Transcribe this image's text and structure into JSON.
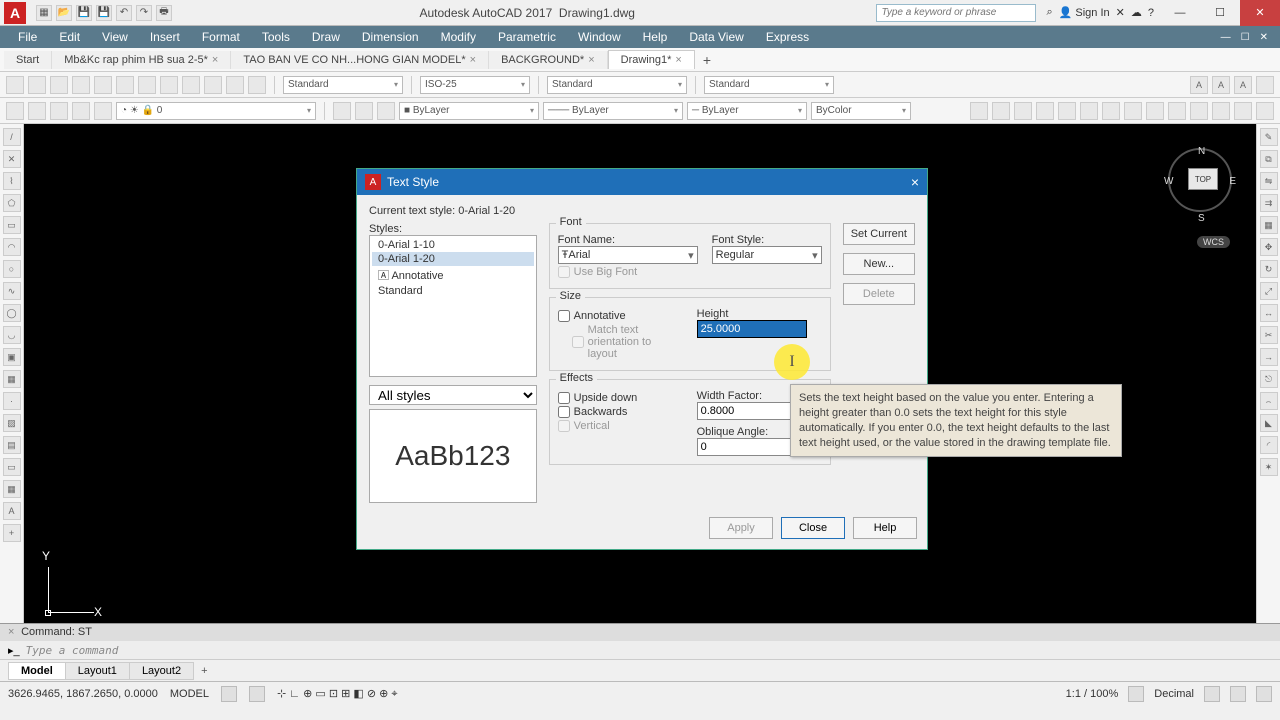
{
  "title": {
    "app": "Autodesk AutoCAD 2017",
    "doc": "Drawing1.dwg",
    "search_ph": "Type a keyword or phrase",
    "signin": "Sign In"
  },
  "menu": [
    "File",
    "Edit",
    "View",
    "Insert",
    "Format",
    "Tools",
    "Draw",
    "Dimension",
    "Modify",
    "Parametric",
    "Window",
    "Help",
    "Data View",
    "Express"
  ],
  "doc_tabs": {
    "start": "Start",
    "t": [
      "Mb&Kc rap phim HB sua 2-5*",
      "TAO BAN VE CO NH...HONG GIAN MODEL*",
      "BACKGROUND*",
      "Drawing1*"
    ]
  },
  "tbar1": {
    "std": "Standard",
    "iso": "ISO-25",
    "std2": "Standard",
    "std3": "Standard"
  },
  "cmd": {
    "history": "Command: ST",
    "prompt": "Type a command"
  },
  "tabs": {
    "model": "Model",
    "l1": "Layout1",
    "l2": "Layout2"
  },
  "status": {
    "coords": "3626.9465, 1867.2650, 0.0000",
    "mode": "MODEL",
    "scale": "1:1 / 100%",
    "dec": "Decimal"
  },
  "viewcube": {
    "top": "TOP",
    "n": "N",
    "s": "S",
    "e": "E",
    "w": "W",
    "wcs": "WCS"
  },
  "dlg": {
    "title": "Text Style",
    "current": "Current text style:  0-Arial 1-20",
    "styles_label": "Styles:",
    "styles": [
      "0-Arial 1-10",
      "0-Arial 1-20",
      "Annotative",
      "Standard"
    ],
    "filter": "All styles",
    "preview": "AaBb123",
    "btn_setcurrent": "Set Current",
    "btn_new": "New...",
    "btn_delete": "Delete",
    "btn_apply": "Apply",
    "btn_close": "Close",
    "btn_help": "Help",
    "font": {
      "group": "Font",
      "name_lbl": "Font Name:",
      "name_val": "Arial",
      "style_lbl": "Font Style:",
      "style_val": "Regular",
      "bigfont": "Use Big Font"
    },
    "size": {
      "group": "Size",
      "anno": "Annotative",
      "match": "Match text orientation to layout",
      "height_lbl": "Height",
      "height_val": "25.0000"
    },
    "fx": {
      "group": "Effects",
      "upside": "Upside down",
      "back": "Backwards",
      "vert": "Vertical",
      "width_lbl": "Width Factor:",
      "width_val": "0.8000",
      "oblique_lbl": "Oblique Angle:",
      "oblique_val": "0"
    }
  },
  "tooltip": "Sets the text height based on the value you enter. Entering a height greater than 0.0 sets the text height for this style automatically. If you enter 0.0, the text height defaults to the last text height used, or the value stored in the drawing template file."
}
